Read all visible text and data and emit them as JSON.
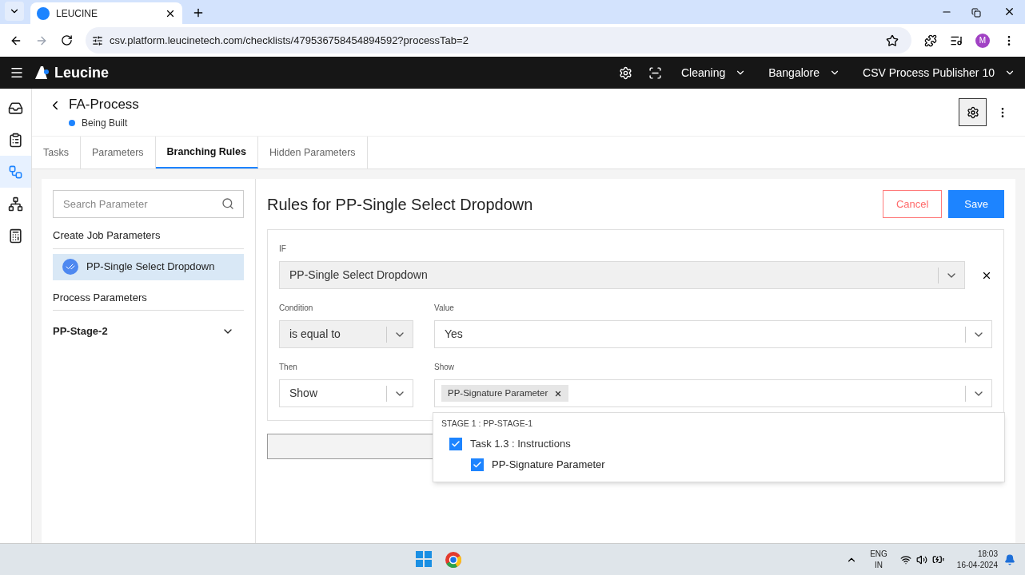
{
  "browser": {
    "tab_title": "LEUCINE",
    "url": "csv.platform.leucinetech.com/checklists/479536758454894592?processTab=2",
    "profile_initial": "M"
  },
  "app_header": {
    "brand": "Leucine",
    "facility": "Cleaning",
    "location": "Bangalore",
    "user": "CSV Process Publisher 10"
  },
  "nav_rail": [
    {
      "selected": false
    },
    {
      "selected": false
    },
    {
      "selected": true
    },
    {
      "selected": false
    },
    {
      "selected": false
    }
  ],
  "process": {
    "title": "FA-Process",
    "status": "Being Built"
  },
  "tabs": [
    {
      "label": "Tasks",
      "selected": false
    },
    {
      "label": "Parameters",
      "selected": false
    },
    {
      "label": "Branching Rules",
      "selected": true
    },
    {
      "label": "Hidden Parameters",
      "selected": false
    }
  ],
  "parameter_panel": {
    "search_placeholder": "Search Parameter",
    "create_job_heading": "Create Job Parameters",
    "create_job_items": [
      {
        "label": "PP-Single Select Dropdown",
        "selected": true
      }
    ],
    "process_heading": "Process Parameters",
    "stages": [
      {
        "label": "PP-Stage-2",
        "expanded": false
      }
    ]
  },
  "rules": {
    "title": "Rules for PP-Single Select Dropdown",
    "cancel": "Cancel",
    "save": "Save",
    "if_label": "IF",
    "if_value": "PP-Single Select Dropdown",
    "condition_label": "Condition",
    "condition_value": "is equal to",
    "value_label": "Value",
    "value_value": "Yes",
    "then_label": "Then",
    "then_value": "Show",
    "show_label": "Show",
    "show_tags": [
      "PP-Signature Parameter"
    ],
    "dropdown": {
      "heading": "STAGE 1 : PP-STAGE-1",
      "items": [
        {
          "label": "Task 1.3 : Instructions",
          "checked": true,
          "children": [
            {
              "label": "PP-Signature Parameter",
              "checked": true
            }
          ]
        }
      ]
    }
  },
  "taskbar": {
    "language": "ENG",
    "region": "IN",
    "time": "18:03",
    "date": "16-04-2024"
  }
}
